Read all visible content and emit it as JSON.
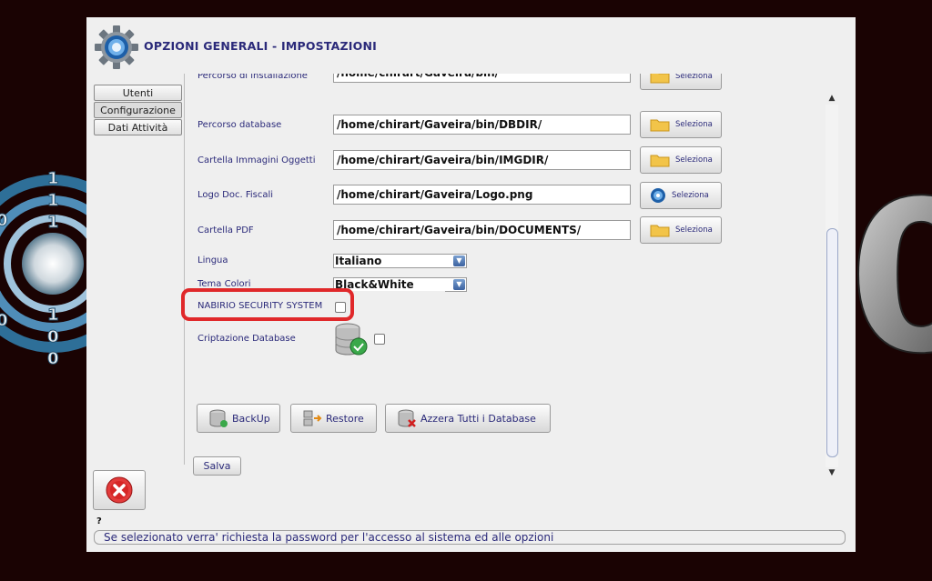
{
  "window": {
    "title": "OPZIONI GENERALI - IMPOSTAZIONI"
  },
  "tabs": [
    {
      "label": "Utenti"
    },
    {
      "label": "Configurazione"
    },
    {
      "label": "Dati Attività"
    }
  ],
  "paths": [
    {
      "label": "Percorso di installazione",
      "value": "/home/chirart/Gaveira/bin/"
    },
    {
      "label": "Percorso database",
      "value": "/home/chirart/Gaveira/bin/DBDIR/"
    },
    {
      "label": "Cartella Immagini Oggetti",
      "value": "/home/chirart/Gaveira/bin/IMGDIR/"
    },
    {
      "label": "Logo Doc. Fiscali",
      "value": "/home/chirart/Gaveira/Logo.png"
    },
    {
      "label": "Cartella PDF",
      "value": "/home/chirart/Gaveira/bin/DOCUMENTS/"
    }
  ],
  "select_button_label": "Seleziona",
  "lingua": {
    "label": "Lingua",
    "value": "Italiano"
  },
  "tema": {
    "label": "Tema Colori",
    "value": "Black&White"
  },
  "security": {
    "label": "NABIRIO SECURITY SYSTEM",
    "checked": false
  },
  "encryption": {
    "label": "Criptazione Database",
    "checked": false
  },
  "actions": {
    "backup": "BackUp",
    "restore": "Restore",
    "reset": "Azzera Tutti i Database"
  },
  "save_label": "Salva",
  "help_mark": "?",
  "status_text": "Se selezionato verra' richiesta la password per l'accesso al sistema ed alle opzioni",
  "background": {
    "left_digits": [
      "1",
      "1",
      "0",
      "1",
      "0",
      "1",
      "0",
      "0"
    ],
    "right_digit": "0"
  },
  "colors": {
    "accent_text": "#2b2a7a",
    "highlight": "#e0282a",
    "background": "#1a0303"
  }
}
